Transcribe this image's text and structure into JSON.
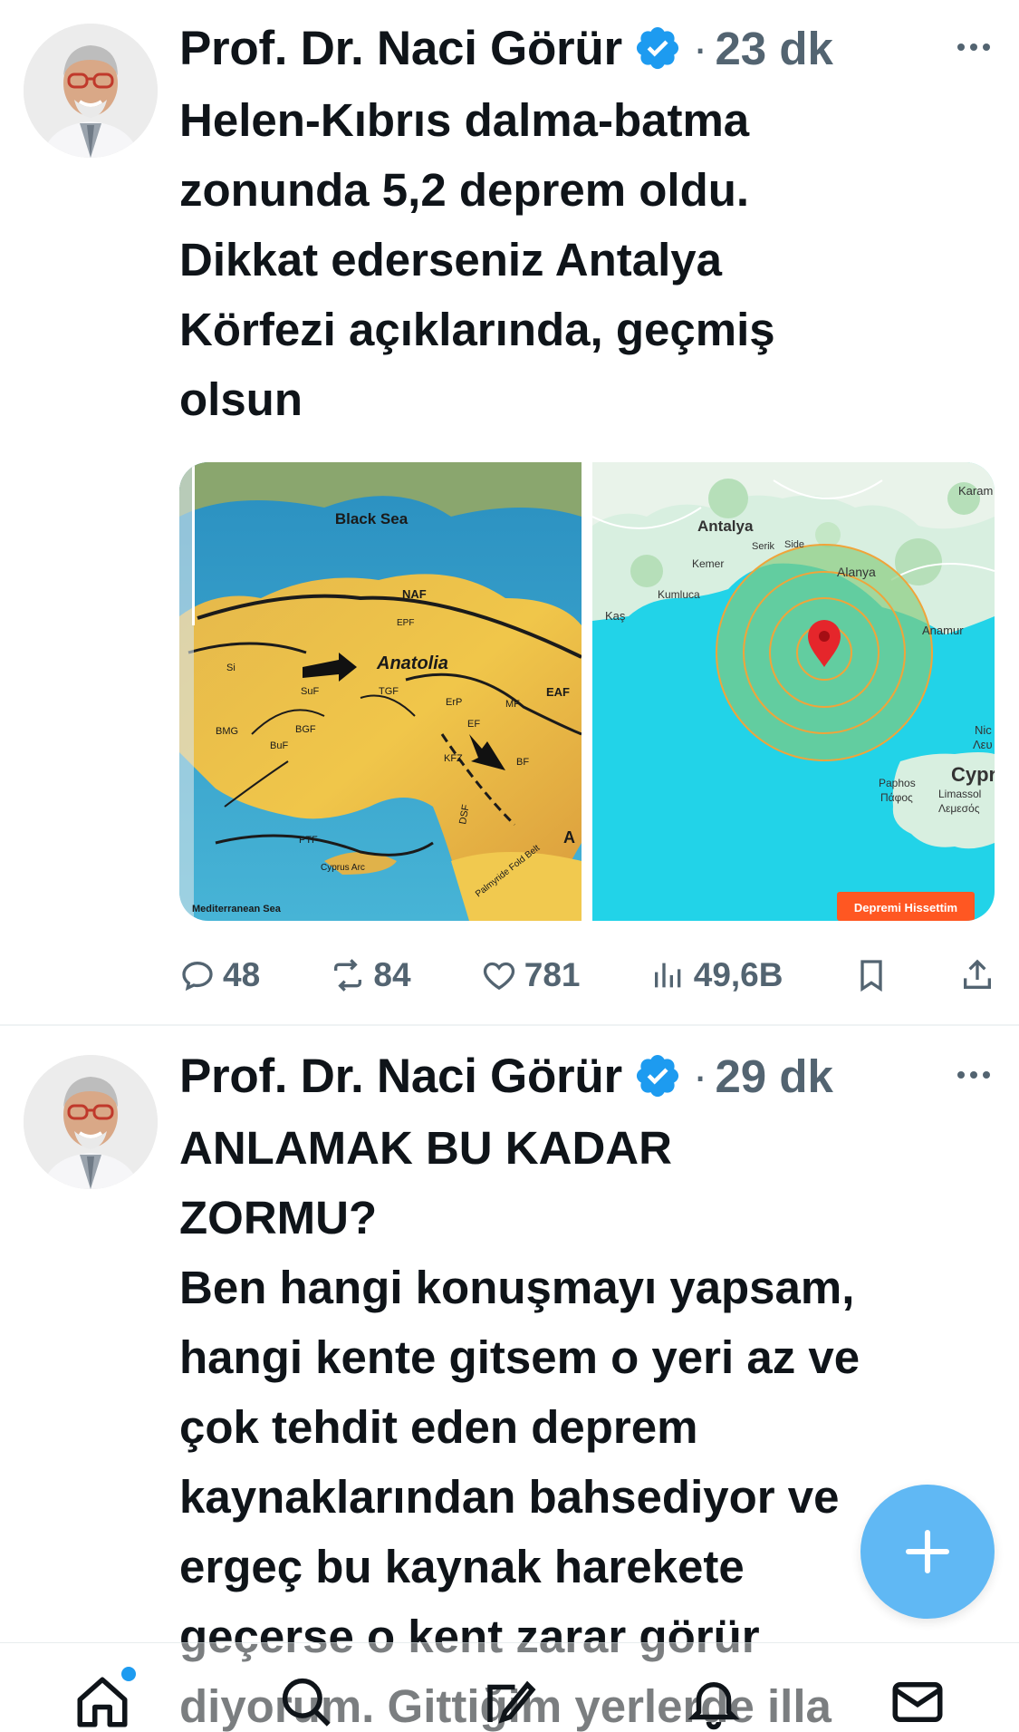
{
  "colors": {
    "accent": "#1d9bf0",
    "text_primary": "#0f1419",
    "text_secondary": "#536471",
    "divider": "#eff3f4"
  },
  "tweets": [
    {
      "author": "Prof. Dr. Naci Görür",
      "verified": true,
      "separator": "·",
      "time": "23 dk",
      "text": "Helen-Kıbrıs dalma-batma\nzonunda 5,2 deprem oldu.\nDikkat ederseniz Antalya\nKörfezi açıklarında, geçmiş\nolsun",
      "media": {
        "tectonic_map": {
          "labels": {
            "black_sea": "Black Sea",
            "anatolia": "Anatolia",
            "naf": "NAF",
            "epf": "EPF",
            "eaf": "EAF",
            "si": "Si",
            "suf": "SuF",
            "tgf": "TGF",
            "erp": "ErP",
            "ef": "EF",
            "mf": "MF",
            "bgf": "BGF",
            "buf": "BuF",
            "bmg": "BMG",
            "kfz": "KFZ",
            "bf": "BF",
            "dsf": "DSF",
            "ptf": "PTF",
            "cyprus_arc": "Cyprus Arc",
            "palmyride": "Palmyride Fold Belt",
            "a": "A",
            "mediterranean_sea": "Mediterranean Sea"
          }
        },
        "quake_map": {
          "labels": {
            "antalya": "Antalya",
            "serik": "Serik",
            "side": "Side",
            "kemer": "Kemer",
            "kumluca": "Kumluca",
            "kas": "Kaş",
            "alanya": "Alanya",
            "anamur": "Anamur",
            "karaman": "Karam",
            "paphos": "Paphos",
            "paphos_gr": "Πάφος",
            "limassol": "Limassol",
            "limassol_gr": "Λεμεσός",
            "cyprus": "Cypr",
            "nicosia": "Nic",
            "nicosia_gr": "Λευ"
          },
          "badge": "Depremi Hissettim"
        }
      },
      "stats": {
        "replies": "48",
        "reposts": "84",
        "likes": "781",
        "views": "49,6B"
      }
    },
    {
      "author": "Prof. Dr. Naci Görür",
      "verified": true,
      "separator": "·",
      "time": "29 dk",
      "text": "ANLAMAK BU KADAR\nZORMU?\nBen hangi konuşmayı yapsam,\nhangi kente gitsem o yeri az ve\nçok tehdit eden deprem\nkaynaklarından bahsediyor ve\nergeç bu kaynak harekete\ngeçerse o kent zarar görür\ndiyorum. Gittiğim yerlerde illa"
    }
  ],
  "fab": {
    "icon": "plus-icon"
  },
  "bottom_nav": {
    "items": [
      "home-icon",
      "search-icon",
      "communities-icon",
      "notifications-icon",
      "messages-icon"
    ],
    "home_has_badge": true
  }
}
